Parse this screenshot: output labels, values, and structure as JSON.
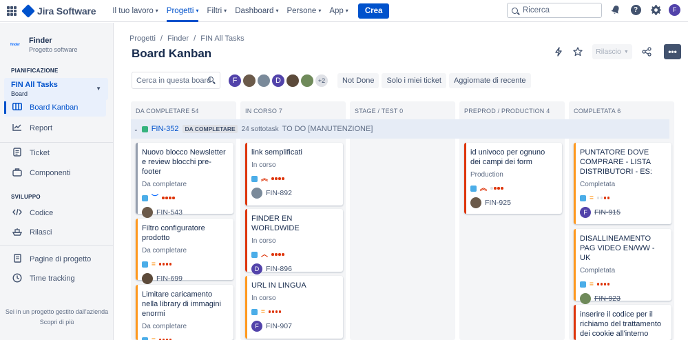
{
  "topnav": {
    "product": "Jira Software",
    "items": [
      {
        "label": "Il tuo lavoro",
        "active": false
      },
      {
        "label": "Progetti",
        "active": true
      },
      {
        "label": "Filtri",
        "active": false
      },
      {
        "label": "Dashboard",
        "active": false
      },
      {
        "label": "Persone",
        "active": false
      },
      {
        "label": "App",
        "active": false
      }
    ],
    "create": "Crea",
    "search_placeholder": "Ricerca",
    "help": "?",
    "user_initial": "F"
  },
  "sidebar": {
    "project_logo_text": "finder",
    "project_name": "Finder",
    "project_type": "Progetto software",
    "planning_head": "PIANIFICAZIONE",
    "board_selector": {
      "title": "FIN All Tasks",
      "subtitle": "Board"
    },
    "items": {
      "kanban": "Board Kanban",
      "report": "Report",
      "ticket": "Ticket",
      "components": "Componenti",
      "code": "Codice",
      "releases": "Rilasci",
      "pages": "Pagine di progetto",
      "time": "Time tracking"
    },
    "dev_head": "SVILUPPO",
    "footer_line1": "Sei in un progetto gestito dall'azienda",
    "footer_line2": "Scopri di più"
  },
  "breadcrumb": [
    "Progetti",
    "/",
    "Finder",
    "/",
    "FIN All Tasks"
  ],
  "page_title": "Board Kanban",
  "release_label": "Rilascio",
  "board_search_placeholder": "Cerca in questa board",
  "avatars": [
    {
      "initial": "F",
      "color": "#5243aa"
    },
    {
      "initial": "",
      "color": "#6b5a4a"
    },
    {
      "initial": "",
      "color": "#7a8a9a"
    },
    {
      "initial": "D",
      "color": "#5243aa"
    },
    {
      "initial": "",
      "color": "#5c4a3a"
    },
    {
      "initial": "",
      "color": "#6f8a5a"
    },
    {
      "initial": "+2",
      "color": "#dfe1e6"
    }
  ],
  "filters": [
    "Not Done",
    "Solo i miei ticket",
    "Aggiornate di recente"
  ],
  "columns": [
    {
      "name": "DA COMPLETARE",
      "count": "54"
    },
    {
      "name": "IN CORSO",
      "count": "7"
    },
    {
      "name": "STAGE / TEST",
      "count": "0"
    },
    {
      "name": "PREPROD / PRODUCTION",
      "count": "4"
    },
    {
      "name": "COMPLETATA",
      "count": "6"
    }
  ],
  "swimlane": {
    "key": "FIN-352",
    "badge": "DA COMPLETARE",
    "subtasks": "24 sottotask",
    "title": "TO DO [MANUTENZIONE]"
  },
  "cards": {
    "c1": {
      "title": "Nuovo blocco Newsletter e review blocchi pre-footer",
      "status": "Da completare",
      "key": "FIN-543"
    },
    "c2": {
      "title": "Filtro configuratore prodotto",
      "status": "Da completare",
      "key": "FIN-699"
    },
    "c3": {
      "title": "Limitare caricamento nella library di immagini enormi",
      "status": "Da completare",
      "key": ""
    },
    "c4": {
      "title": "link semplificati",
      "status": "In corso",
      "key": "FIN-892"
    },
    "c5": {
      "title": "FINDER EN WORLDWIDE",
      "status": "In corso",
      "key": "FIN-896",
      "avatar": "D"
    },
    "c6": {
      "title": "URL IN LINGUA",
      "status": "In corso",
      "key": "FIN-907",
      "avatar": "F"
    },
    "c7": {
      "title": "id univoco per ognuno dei campi dei form",
      "status": "Production",
      "key": "FIN-925"
    },
    "c8": {
      "title": "PUNTATORE DOVE COMPRARE - LISTA DISTRIBUTORI - ES:",
      "status": "Completata",
      "key": "FIN-915",
      "avatar": "F"
    },
    "c9": {
      "title": "DISALLINEAMENTO PAG VIDEO EN/WW - UK",
      "status": "Completata",
      "key": "FIN-923"
    },
    "c10": {
      "title": "inserire il codice per il richiamo del trattamento dei cookie all'interno della",
      "status": "",
      "key": ""
    }
  }
}
